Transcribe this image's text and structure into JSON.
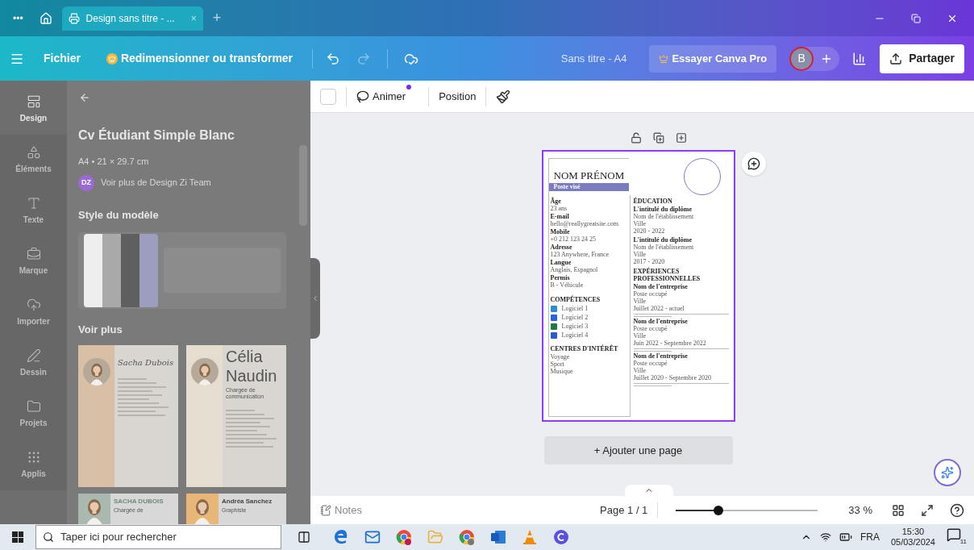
{
  "browser": {
    "menu": "•••",
    "tab": {
      "title": "Design sans titre - ...",
      "close": "×",
      "selected": true
    },
    "new_tab": "+"
  },
  "toolbar": {
    "file": "Fichier",
    "resize": "Redimensionner ou transformer",
    "redo_disabled": true,
    "doc_title": "Sans titre - A4",
    "pro": "Essayer Canva Pro",
    "avatar": "B",
    "share": "Partager"
  },
  "rail": [
    {
      "label": "Design",
      "selected": true
    },
    {
      "label": "Éléments",
      "selected": false
    },
    {
      "label": "Texte",
      "selected": false
    },
    {
      "label": "Marque",
      "selected": false
    },
    {
      "label": "Importer",
      "selected": false
    },
    {
      "label": "Dessin",
      "selected": false
    },
    {
      "label": "Projets",
      "selected": false
    },
    {
      "label": "Applis",
      "selected": false
    }
  ],
  "panel": {
    "title": "Cv Étudiant Simple Blanc",
    "size": "A4 • 21 × 29.7 cm",
    "author_badge": "DZ",
    "author_link": "Voir plus de Design Zi Team",
    "style_heading": "Style du modèle",
    "swatches": [
      {
        "color": "#eeeeee"
      },
      {
        "color": "#a9a9a9"
      },
      {
        "color": "#5f5f5f"
      },
      {
        "color": "#9d9dc0"
      }
    ],
    "more_heading": "Voir plus",
    "templates": [
      {
        "kind": "script",
        "name": "Sacha Dubois"
      },
      {
        "kind": "large",
        "name": "Célia",
        "name2": "Naudin",
        "subtitle": "Chargée de communication"
      },
      {
        "kind": "banner",
        "name": "SACHA DUBOIS",
        "subtitle": "Chargée de"
      },
      {
        "kind": "banner",
        "name": "Andréa Sanchez",
        "subtitle": "Graphiste"
      }
    ]
  },
  "context_toolbar": {
    "animate": "Animer",
    "position": "Position"
  },
  "cv": {
    "name": "NOM PRÉNOM",
    "role": "Poste visé",
    "details": [
      {
        "label": "Âge",
        "value": "23 ans"
      },
      {
        "label": "E-mail",
        "value": "hello@reallygreatsite.com"
      },
      {
        "label": "Mobile",
        "value": "+0 212 123 24 25"
      },
      {
        "label": "Adresse",
        "value": "123 Anywhere, France"
      },
      {
        "label": "Langue",
        "value": "Anglais, Espagnol"
      },
      {
        "label": "Permis",
        "value": "B - Véhicule"
      }
    ],
    "skills_heading": "COMPÉTENCES",
    "skills": [
      {
        "name": "Logiciel 1",
        "color": "#2b8fd6"
      },
      {
        "name": "Logiciel 2",
        "color": "#2563eb"
      },
      {
        "name": "Logiciel 3",
        "color": "#1f7a43"
      },
      {
        "name": "Logiciel 4",
        "color": "#2a5bd7"
      }
    ],
    "interests_heading": "CENTRES D'INTÉRÊT",
    "interests": [
      "Voyage",
      "Sport",
      "Musique"
    ],
    "education_heading": "ÉDUCATION",
    "education": [
      {
        "title": "L'intitulé du diplôme",
        "school": "Nom de l'établissement",
        "city": "Ville",
        "dates": "2020 - 2022"
      },
      {
        "title": "L'intitulé du diplôme",
        "school": "Nom de l'établissement",
        "city": "Ville",
        "dates": "2017 - 2020"
      }
    ],
    "experience_heading": "EXPÉRIENCES PROFESSIONNELLES",
    "experience": [
      {
        "company": "Nom de l'entreprise",
        "role": "Poste occupé",
        "city": "Ville",
        "dates": "Juillet 2022 - actuel"
      },
      {
        "company": "Nom de l'entreprise",
        "role": "Poste occupé",
        "city": "Ville",
        "dates": "Juin 2022 - Septembre 2022"
      },
      {
        "company": "Nom de l'entreprise",
        "role": "Poste occupé",
        "city": "Ville",
        "dates": "Juillet 2020 - Septembre 2020"
      }
    ]
  },
  "add_page": "+ Ajouter une page",
  "footer": {
    "notes": "Notes",
    "page": "Page 1 / 1",
    "zoom": {
      "level": 0.3
    },
    "zoom_text": "33 %"
  },
  "taskbar": {
    "search_placeholder": "Taper ici pour rechercher",
    "lang": "FRA",
    "time": "15:30",
    "date": "05/03/2024",
    "notifications": "11"
  }
}
